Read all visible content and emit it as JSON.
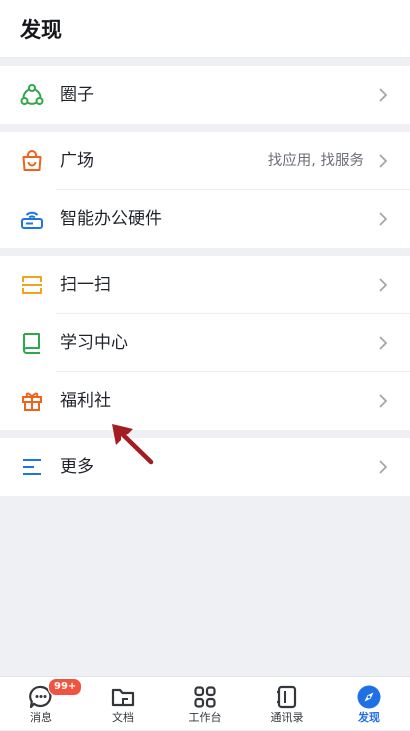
{
  "header": {
    "title": "发现"
  },
  "sections": [
    {
      "items": [
        {
          "label": "圈子",
          "icon": "circle-people-icon",
          "color": "#2ea84a"
        }
      ]
    },
    {
      "items": [
        {
          "label": "广场",
          "hint": "找应用, 找服务",
          "icon": "shopping-bag-icon",
          "color": "#f0631d"
        },
        {
          "label": "智能办公硬件",
          "icon": "router-icon",
          "color": "#1f74e0"
        }
      ]
    },
    {
      "items": [
        {
          "label": "扫一扫",
          "icon": "scan-icon",
          "color": "#f5a11c"
        },
        {
          "label": "学习中心",
          "icon": "book-icon",
          "color": "#2ea84a"
        },
        {
          "label": "福利社",
          "icon": "gift-icon",
          "color": "#f0631d"
        }
      ]
    },
    {
      "items": [
        {
          "label": "更多",
          "icon": "menu-icon",
          "color": "#1f74e0"
        }
      ]
    }
  ],
  "tabbar": {
    "tabs": [
      {
        "label": "消息",
        "icon": "chat-icon",
        "badge": "99+"
      },
      {
        "label": "文档",
        "icon": "folder-icon"
      },
      {
        "label": "工作台",
        "icon": "grid-icon"
      },
      {
        "label": "通讯录",
        "icon": "contacts-icon"
      },
      {
        "label": "发现",
        "icon": "discover-icon",
        "active": true
      }
    ]
  },
  "colors": {
    "accent": "#1f6fe5",
    "badge": "#f0543e",
    "annotation_arrow": "#a31c22"
  }
}
